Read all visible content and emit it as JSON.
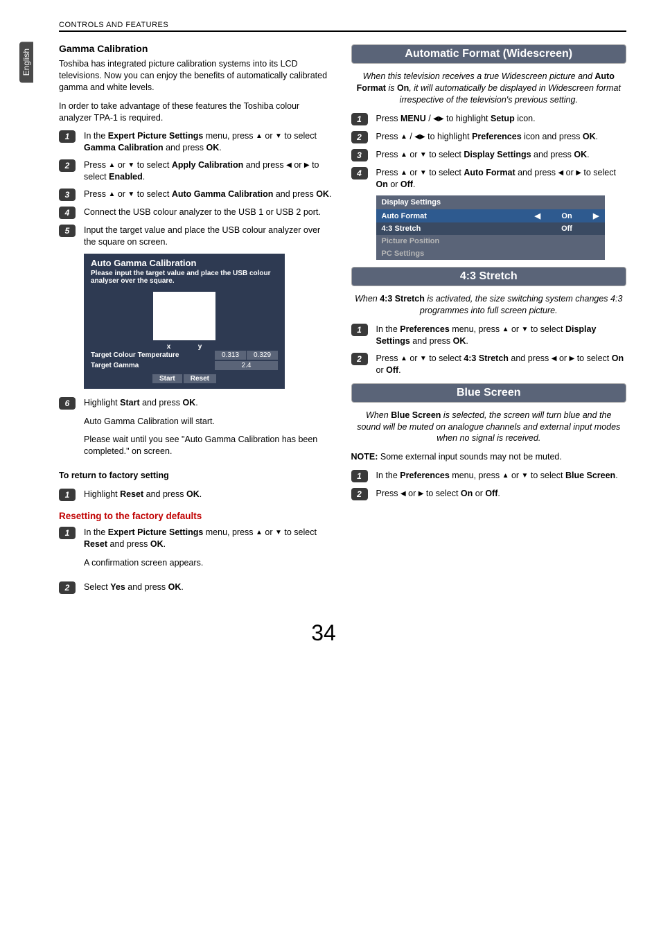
{
  "header": "CONTROLS AND FEATURES",
  "lang_tab": "English",
  "page_number": "34",
  "left": {
    "h1": "Gamma Calibration",
    "p1": "Toshiba has integrated picture calibration systems into its LCD televisions. Now you can enjoy the benefits of automatically calibrated gamma and white levels.",
    "p2": "In order to take advantage of these features the Toshiba colour analyzer TPA-1 is required.",
    "s1a": "In the ",
    "s1b": "Expert Picture Settings",
    "s1c": " menu, press ",
    "s1d": " or ",
    "s1e": " to select ",
    "s1f": "Gamma Calibration",
    "s1g": " and press ",
    "s1h": "OK",
    "s1i": ".",
    "s2a": "Press ",
    "s2b": " or ",
    "s2c": " to select ",
    "s2d": "Apply Calibration",
    "s2e": " and press ",
    "s2f": " or ",
    "s2g": " to select ",
    "s2h": "Enabled",
    "s2i": ".",
    "s3a": "Press ",
    "s3b": " or ",
    "s3c": " to select ",
    "s3d": "Auto Gamma Calibration",
    "s3e": " and press ",
    "s3f": "OK",
    "s3g": ".",
    "s4": "Connect the USB colour analyzer to the USB 1 or USB 2 port.",
    "s5": "Input the target value and place the USB colour analyzer over the square on screen.",
    "gamma_dialog": {
      "title": "Auto Gamma Calibration",
      "subtitle": "Please input the target value and place the USB colour analyser over the square.",
      "x": "x",
      "y": "y",
      "tct_label": "Target Colour Temperature",
      "tct_x": "0.313",
      "tct_y": "0.329",
      "tg_label": "Target Gamma",
      "tg_val": "2.4",
      "start": "Start",
      "reset": "Reset"
    },
    "s6a": "Highlight ",
    "s6b": "Start",
    "s6c": " and press ",
    "s6d": "OK",
    "s6e": ".",
    "s6p1": "Auto Gamma Calibration will start.",
    "s6p2": "Please wait until you see \"Auto Gamma Calibration has been completed.\" on screen.",
    "return_h": "To return to factory setting",
    "r1a": "Highlight ",
    "r1b": "Reset",
    "r1c": " and press ",
    "r1d": "OK",
    "r1e": ".",
    "reset_h": "Resetting to the factory defaults",
    "f1a": "In the ",
    "f1b": "Expert Picture Settings",
    "f1c": " menu, press ",
    "f1d": " or ",
    "f1e": " to select ",
    "f1f": "Reset",
    "f1g": " and press ",
    "f1h": "OK",
    "f1i": ".",
    "f1p": "A confirmation screen appears.",
    "f2a": "Select ",
    "f2b": "Yes",
    "f2c": " and press ",
    "f2d": "OK",
    "f2e": "."
  },
  "right": {
    "band1": "Automatic Format (Widescreen)",
    "intro1a": "When this television receives a true Widescreen picture and ",
    "intro1b": "Auto Format",
    "intro1c": " is ",
    "intro1d": "On",
    "intro1e": ", it will automatically be displayed in Widescreen format irrespective of the television's previous setting.",
    "a1a": "Press ",
    "a1b": "MENU",
    "a1c": " / ",
    "a1d": " to highlight ",
    "a1e": "Setup",
    "a1f": " icon.",
    "a2a": "Press ",
    "a2b": " / ",
    "a2c": " to highlight ",
    "a2d": "Preferences",
    "a2e": " icon and press ",
    "a2f": "OK",
    "a2g": ".",
    "a3a": "Press ",
    "a3b": " or ",
    "a3c": " to select ",
    "a3d": "Display Settings",
    "a3e": " and press ",
    "a3f": "OK",
    "a3g": ".",
    "a4a": "Press ",
    "a4b": " or ",
    "a4c": " to select ",
    "a4d": "Auto Format",
    "a4e": " and press ",
    "a4f": " or ",
    "a4g": " to select ",
    "a4h": "On",
    "a4i": " or ",
    "a4j": "Off",
    "a4k": ".",
    "table": {
      "header": "Display Settings",
      "r1": "Auto Format",
      "r1v": "On",
      "r2": "4:3 Stretch",
      "r2v": "Off",
      "r3": "Picture Position",
      "r4": "PC Settings"
    },
    "band2": "4:3 Stretch",
    "intro2a": "When ",
    "intro2b": "4:3 Stretch",
    "intro2c": " is activated, the size switching system changes 4:3 programmes into full screen picture.",
    "b1a": "In the ",
    "b1b": "Preferences",
    "b1c": " menu, press ",
    "b1d": " or ",
    "b1e": " to select ",
    "b1f": "Display Settings",
    "b1g": " and press ",
    "b1h": "OK",
    "b1i": ".",
    "b2a": "Press ",
    "b2b": " or ",
    "b2c": " to select ",
    "b2d": "4:3 Stretch",
    "b2e": " and press ",
    "b2f": " or ",
    "b2g": " to select ",
    "b2h": "On",
    "b2i": " or ",
    "b2j": "Off",
    "b2k": ".",
    "band3": "Blue Screen",
    "intro3a": "When ",
    "intro3b": "Blue Screen",
    "intro3c": " is selected, the screen will turn blue and the sound will be muted on analogue channels and external input modes when no signal is received.",
    "note_label": "NOTE:",
    "note_body": " Some external input sounds may not be muted.",
    "c1a": "In the ",
    "c1b": "Preferences",
    "c1c": " menu, press ",
    "c1d": " or ",
    "c1e": " to select ",
    "c1f": "Blue Screen",
    "c1g": ".",
    "c2a": "Press ",
    "c2b": " or ",
    "c2c": " to select ",
    "c2d": "On",
    "c2e": " or ",
    "c2f": "Off",
    "c2g": "."
  }
}
